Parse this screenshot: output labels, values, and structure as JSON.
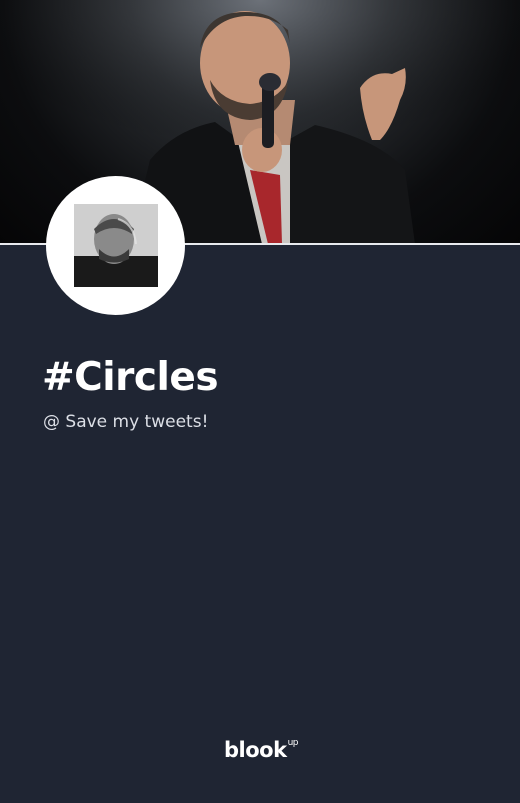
{
  "header": {
    "cover_photo": "performer-with-microphone-photo"
  },
  "profile": {
    "avatar": "album-cover-avatar",
    "hashtag": "#Circles",
    "subtitle": "@ Save my tweets!"
  },
  "footer": {
    "brand_name": "blook",
    "brand_superscript": "up"
  },
  "colors": {
    "background": "#1f2533",
    "title_text": "#ffffff",
    "subtitle_text": "#dcdfe6",
    "divider": "#e8eaee"
  }
}
